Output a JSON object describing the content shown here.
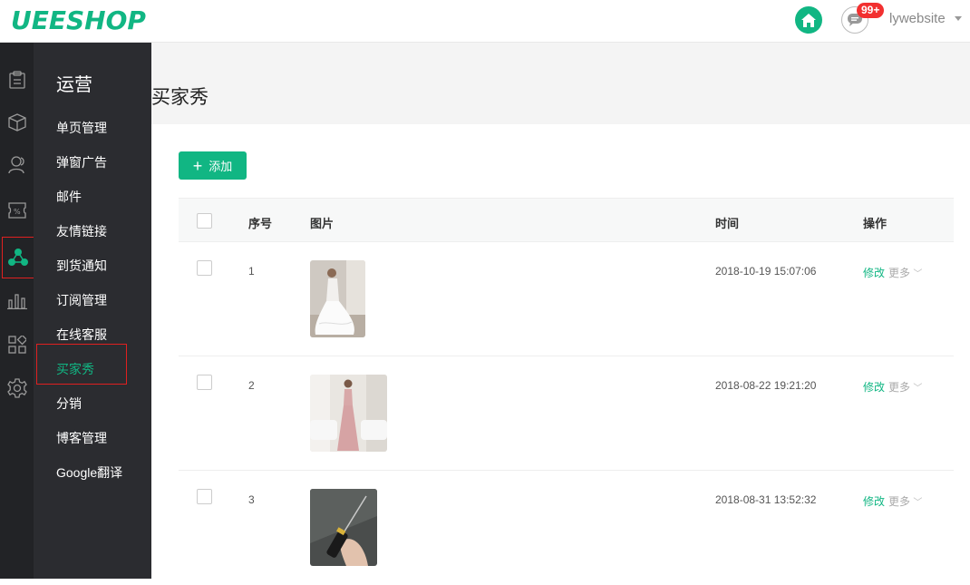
{
  "header": {
    "logo": "UEESHOP",
    "badge": "99+",
    "username": "lywebsite"
  },
  "rail": {
    "icons": [
      "clipboard-icon",
      "box-icon",
      "users-icon",
      "discount-icon",
      "operations-icon",
      "chart-icon",
      "apps-icon",
      "gear-icon"
    ],
    "active_index": 4,
    "active_color": "#11b683"
  },
  "subnav": {
    "title": "运营",
    "items": [
      "单页管理",
      "弹窗广告",
      "邮件",
      "友情链接",
      "到货通知",
      "订阅管理",
      "在线客服",
      "买家秀",
      "分销",
      "博客管理",
      "Google翻译"
    ],
    "active_index": 7
  },
  "main": {
    "title": "买家秀",
    "add_label": "添加",
    "table": {
      "headers": {
        "index": "序号",
        "image": "图片",
        "time": "时间",
        "action": "操作"
      },
      "rows": [
        {
          "index": "1",
          "time": "2018-10-19 15:07:06",
          "edit": "修改",
          "more": "更多"
        },
        {
          "index": "2",
          "time": "2018-08-22 19:21:20",
          "edit": "修改",
          "more": "更多"
        },
        {
          "index": "3",
          "time": "2018-08-31 13:52:32",
          "edit": "修改",
          "more": "更多"
        }
      ]
    }
  },
  "colors": {
    "accent": "#11b683",
    "badge": "#f23030",
    "sidebar": "#2b2c30",
    "rail": "#222326"
  }
}
